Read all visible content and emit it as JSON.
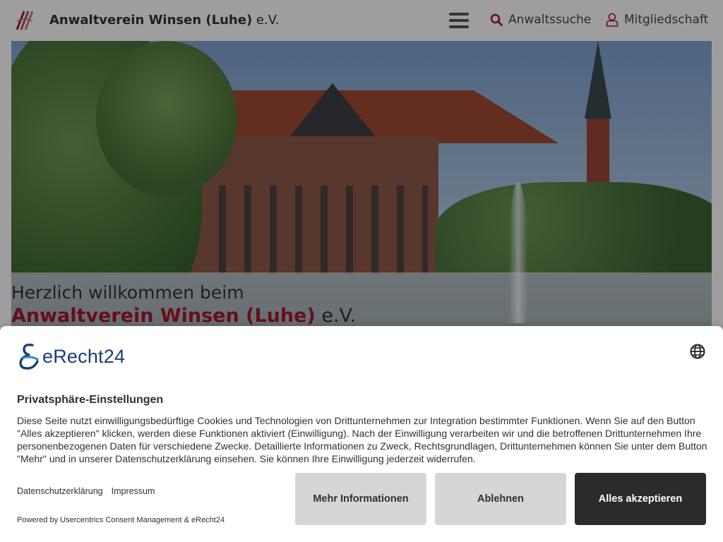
{
  "header": {
    "site_name_bold": "Anwaltverein Winsen (Luhe)",
    "site_name_suffix": "e.V.",
    "search_link": "Anwaltssuche",
    "membership_link": "Mitgliedschaft"
  },
  "hero": {
    "welcome_line": "Herzlich willkommen beim",
    "welcome_name": "Anwaltverein Winsen (Luhe)",
    "welcome_suffix": "e.V."
  },
  "consent": {
    "brand": "eRecht24",
    "title": "Privatsphäre-Einstellungen",
    "description": "Diese Seite nutzt einwilligungsbedürftige Cookies und Technologien von Drittunternehmen zur Integration bestimmter Funktionen. Wenn Sie auf den Button \"Alles akzeptieren\" klicken, werden diese Funktionen aktiviert (Einwilligung). Nach der Einwilligung verarbeiten wir und die betroffenen Drittunternehmen Ihre personenbezogenen Daten für verschiedene Zwecke. Detaillierte Informationen zu Zweck, Rechtsgrundlagen, Drittunternehmen können Sie unter dem Button \"Mehr\" und in unserer Datenschutzerklärung einsehen. Sie können Ihre Einwilligung jederzeit widerrufen.",
    "link_privacy": "Datenschutzerklärung",
    "link_imprint": "Impressum",
    "powered_by": "Powered by Usercentrics Consent Management & eRecht24",
    "btn_more": "Mehr Informationen",
    "btn_deny": "Ablehnen",
    "btn_accept": "Alles akzeptieren"
  },
  "colors": {
    "brand_red": "#a5172d",
    "accept_bg": "#2b2b2b",
    "secondary_btn_bg": "#d6d6d6",
    "erecht_blue": "#1b3f72"
  },
  "icons": [
    "logo-mark-icon",
    "hamburger-menu-icon",
    "search-icon",
    "user-icon",
    "erecht24-logo-icon",
    "globe-icon"
  ]
}
